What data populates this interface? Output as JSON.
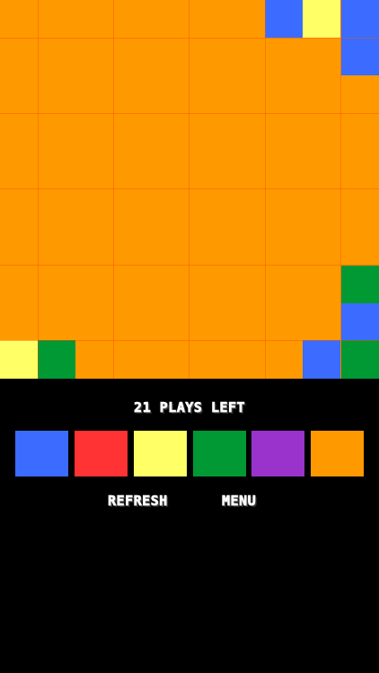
{
  "colors": {
    "blue": "#3b6cff",
    "red": "#ff3333",
    "yellow": "#ffff66",
    "green": "#009933",
    "purple": "#9933cc",
    "orange": "#ff9900"
  },
  "board": {
    "cols": 5,
    "rows": 5,
    "default_color": "orange",
    "special_cells": [
      {
        "row": 0,
        "col": 3.5,
        "color": "blue"
      },
      {
        "row": 0,
        "col": 4,
        "color": "yellow"
      },
      {
        "row": 0,
        "col": 4.5,
        "color": "blue"
      },
      {
        "row": 0.5,
        "col": 4.5,
        "color": "blue"
      },
      {
        "row": 3.5,
        "col": 4.5,
        "color": "green"
      },
      {
        "row": 4,
        "col": 4.5,
        "color": "blue"
      },
      {
        "row": 4.5,
        "col": 0,
        "color": "yellow"
      },
      {
        "row": 4.5,
        "col": 0.5,
        "color": "green"
      },
      {
        "row": 4.5,
        "col": 4,
        "color": "blue"
      },
      {
        "row": 4.5,
        "col": 4.5,
        "color": "green"
      }
    ]
  },
  "status": {
    "plays_left_text": "21 PLAYS LEFT"
  },
  "palette": [
    "blue",
    "red",
    "yellow",
    "green",
    "purple",
    "orange"
  ],
  "buttons": {
    "refresh_label": "REFRESH",
    "menu_label": "MENU"
  }
}
